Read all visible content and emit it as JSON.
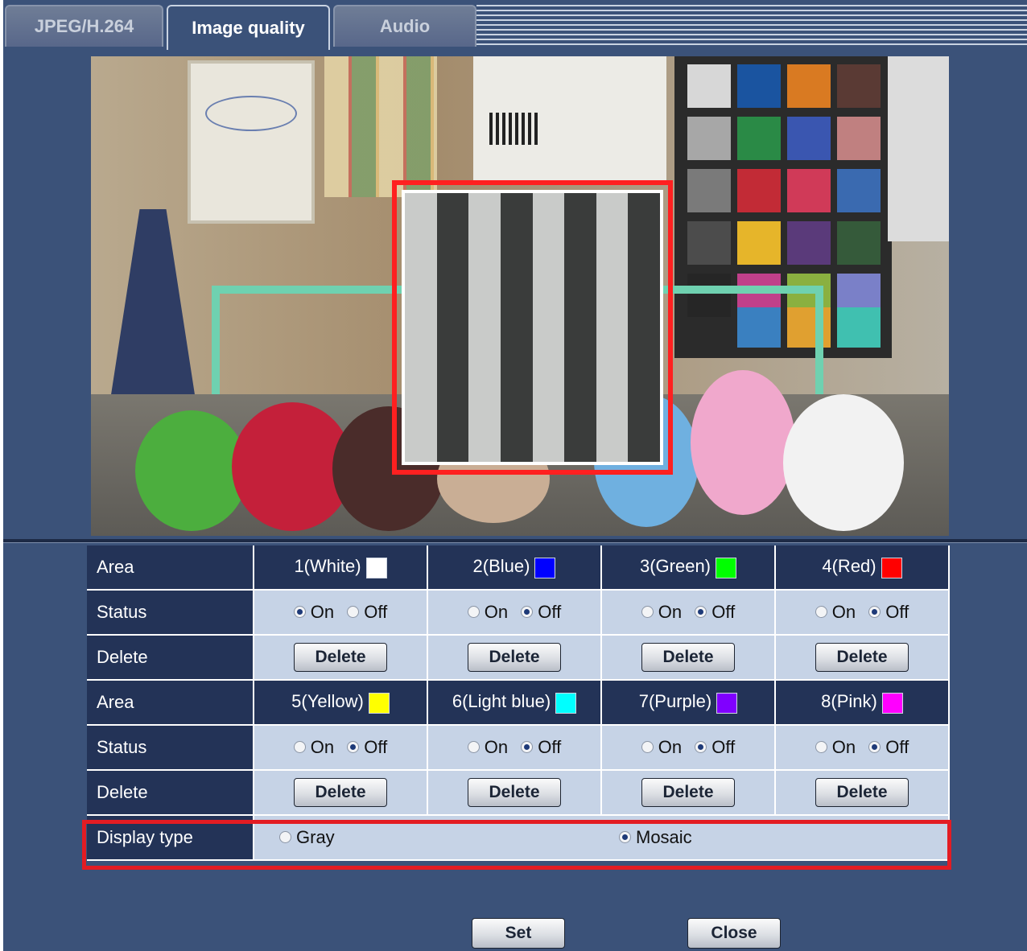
{
  "tabs": [
    {
      "label": "JPEG/H.264",
      "active": false
    },
    {
      "label": "Image quality",
      "active": true
    },
    {
      "label": "Audio",
      "active": false
    }
  ],
  "privacy_zones": {
    "row_labels": {
      "area": "Area",
      "status": "Status",
      "delete": "Delete"
    },
    "on_label": "On",
    "off_label": "Off",
    "delete_button": "Delete",
    "areas": [
      {
        "name": "1(White)",
        "color": "#ffffff",
        "status": "On"
      },
      {
        "name": "2(Blue)",
        "color": "#0000ff",
        "status": "Off"
      },
      {
        "name": "3(Green)",
        "color": "#00ff00",
        "status": "Off"
      },
      {
        "name": "4(Red)",
        "color": "#ff0000",
        "status": "Off"
      },
      {
        "name": "5(Yellow)",
        "color": "#ffff00",
        "status": "Off"
      },
      {
        "name": "6(Light blue)",
        "color": "#00ffff",
        "status": "Off"
      },
      {
        "name": "7(Purple)",
        "color": "#8000ff",
        "status": "Off"
      },
      {
        "name": "8(Pink)",
        "color": "#ff00ff",
        "status": "Off"
      }
    ]
  },
  "display_type": {
    "label": "Display type",
    "options": [
      "Gray",
      "Mosaic"
    ],
    "selected": "Mosaic"
  },
  "footer": {
    "set_label": "Set",
    "close_label": "Close"
  },
  "colors": {
    "background": "#3b5279",
    "header_cell": "#233357",
    "value_cell": "#c6d3e6",
    "highlight": "#e31c23"
  }
}
